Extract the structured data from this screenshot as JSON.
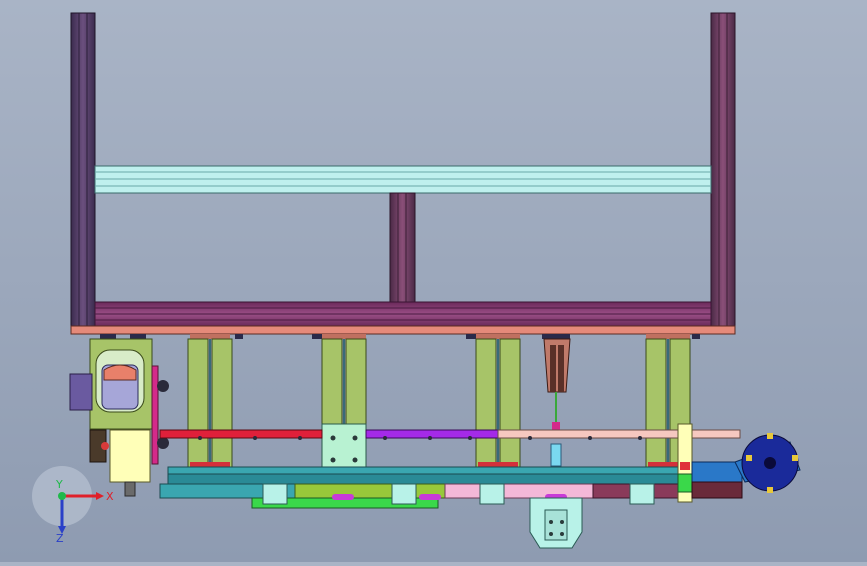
{
  "triad": {
    "x_label": "X",
    "y_label": "Y",
    "z_label": "Z",
    "x_color": "#e0202a",
    "y_color": "#1fb84a",
    "z_color": "#2a40c8"
  },
  "colors": {
    "background_top": "#a9b4c6",
    "background_bottom": "#8e9bb1",
    "frame_purple": "#5a3d6a",
    "frame_magenta": "#7a2c5a",
    "rail_cyan": "#bff0ee",
    "green_block": "#a7c468",
    "base_plate": "#e58a7a",
    "conveyor_teal": "#3aa6b0",
    "gear_blue": "#1a2a9a",
    "gripper_blue": "#2a78c8"
  }
}
